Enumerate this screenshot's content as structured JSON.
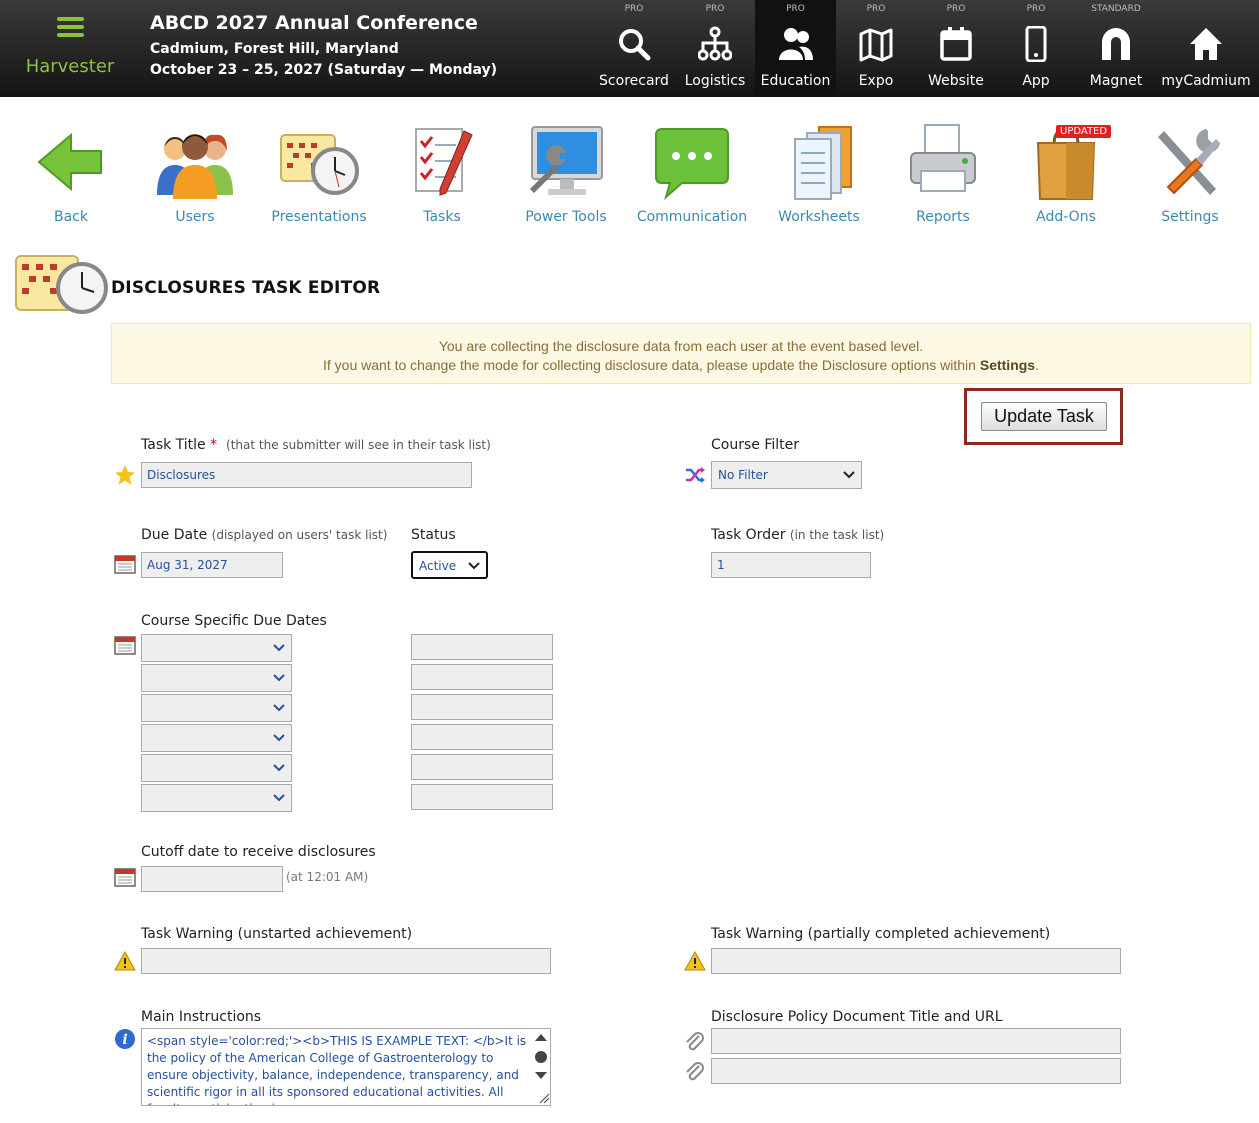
{
  "brand": {
    "name": "Harvester"
  },
  "conference": {
    "title": "ABCD 2027 Annual Conference",
    "location": "Cadmium, Forest Hill, Maryland",
    "dates": "October 23 – 25, 2027 (Saturday — Monday)"
  },
  "nav": [
    {
      "tier": "PRO",
      "label": "Scorecard",
      "icon": "search-icon"
    },
    {
      "tier": "PRO",
      "label": "Logistics",
      "icon": "network-icon"
    },
    {
      "tier": "PRO",
      "label": "Education",
      "icon": "people-icon",
      "active": true
    },
    {
      "tier": "PRO",
      "label": "Expo",
      "icon": "map-icon"
    },
    {
      "tier": "PRO",
      "label": "Website",
      "icon": "calendar-icon"
    },
    {
      "tier": "PRO",
      "label": "App",
      "icon": "phone-icon"
    },
    {
      "tier": "STANDARD",
      "label": "Magnet",
      "icon": "magnet-icon"
    },
    {
      "tier": "",
      "label": "myCadmium",
      "icon": "home-icon"
    }
  ],
  "tools": [
    {
      "label": "Back",
      "icon": "back-arrow-icon"
    },
    {
      "label": "Users",
      "icon": "users-icon"
    },
    {
      "label": "Presentations",
      "icon": "calendar-clock-icon"
    },
    {
      "label": "Tasks",
      "icon": "checklist-icon"
    },
    {
      "label": "Power Tools",
      "icon": "monitor-wrench-icon"
    },
    {
      "label": "Communication",
      "icon": "chat-bubble-icon"
    },
    {
      "label": "Worksheets",
      "icon": "documents-icon"
    },
    {
      "label": "Reports",
      "icon": "printer-icon"
    },
    {
      "label": "Add-Ons",
      "icon": "shopping-bag-icon",
      "badge": "UPDATED"
    },
    {
      "label": "Settings",
      "icon": "tools-icon"
    }
  ],
  "page": {
    "title": "DISCLOSURES TASK EDITOR"
  },
  "notice": {
    "line1": "You are collecting the disclosure data from each user at the event based level.",
    "line2_prefix": "If you want to change the mode for collecting disclosure data, please update the Disclosure options within ",
    "line2_link": "Settings",
    "line2_suffix": "."
  },
  "update_button": "Update Task",
  "form": {
    "task_title": {
      "label": "Task Title",
      "required": "*",
      "hint": "(that the submitter will see in their task list)",
      "value": "Disclosures"
    },
    "course_filter": {
      "label": "Course Filter",
      "value": "No Filter"
    },
    "due_date": {
      "label": "Due Date",
      "hint": "(displayed on users' task list)",
      "value": "Aug 31, 2027"
    },
    "status": {
      "label": "Status",
      "value": "Active"
    },
    "task_order": {
      "label": "Task Order",
      "hint": "(in the task list)",
      "value": "1"
    },
    "course_due_dates": {
      "label": "Course Specific Due Dates",
      "rows": [
        "",
        "",
        "",
        "",
        "",
        ""
      ]
    },
    "cutoff": {
      "label": "Cutoff date to receive disclosures",
      "value": "",
      "suffix": "(at 12:01 AM)"
    },
    "warning_unstarted": {
      "label": "Task Warning (unstarted achievement)",
      "value": ""
    },
    "warning_partial": {
      "label": "Task Warning (partially completed achievement)",
      "value": ""
    },
    "main_instructions": {
      "label": "Main Instructions",
      "value": "<span style='color:red;'><b>THIS IS EXAMPLE TEXT: </b>It is the policy of the American College of Gastroenterology to ensure objectivity, balance, independence, transparency, and scientific rigor in all its sponsored educational activities. All faculty participating in"
    },
    "policy_doc": {
      "label": "Disclosure Policy Document Title and URL",
      "title_value": "",
      "url_value": ""
    }
  },
  "colors": {
    "brand_green": "#8ac43f",
    "link_blue": "#3a8ab0",
    "notice_bg": "#fcf8e3",
    "highlight_border": "#8b2a1e"
  }
}
